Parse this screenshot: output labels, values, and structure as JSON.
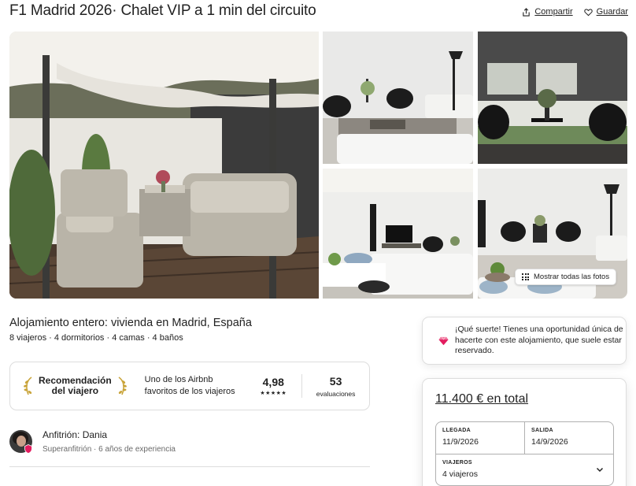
{
  "listing": {
    "title": "F1 Madrid 2026· Chalet VIP a 1 min del circuito",
    "share_label": "Compartir",
    "save_label": "Guardar",
    "show_photos_label": "Mostrar todas las fotos"
  },
  "summary": {
    "heading": "Alojamiento entero: vivienda en Madrid, España",
    "details": "8 viajeros · 4 dormitorios · 4 camas · 4 baños"
  },
  "guest_favorite": {
    "badge_line1": "Recomendación",
    "badge_line2": "del viajero",
    "description": "Uno de los Airbnb favoritos de los viajeros",
    "rating": "4,98",
    "stars": "★★★★★",
    "reviews_count": "53",
    "reviews_label": "evaluaciones"
  },
  "host": {
    "name": "Anfitrión: Dania",
    "subtitle": "Superanfitrión · 6 años de experiencia"
  },
  "rare_find": {
    "text": "¡Qué suerte! Tienes una oportunidad única de hacerte con este alojamiento, que suele estar reservado."
  },
  "booking": {
    "total_price": "11.400 € en total",
    "checkin_label": "LLEGADA",
    "checkin_value": "11/9/2026",
    "checkout_label": "SALIDA",
    "checkout_value": "14/9/2026",
    "guests_label": "VIAJEROS",
    "guests_value": "4 viajeros"
  },
  "colors": {
    "text": "#222222",
    "muted": "#6a6a6a",
    "border": "#dddddd",
    "gem": "#e31c5f"
  },
  "icons": [
    "share-icon",
    "heart-icon",
    "grid-dots-icon",
    "laurel-left-icon",
    "laurel-right-icon",
    "gem-icon",
    "chevron-down-icon",
    "superhost-badge-icon"
  ]
}
